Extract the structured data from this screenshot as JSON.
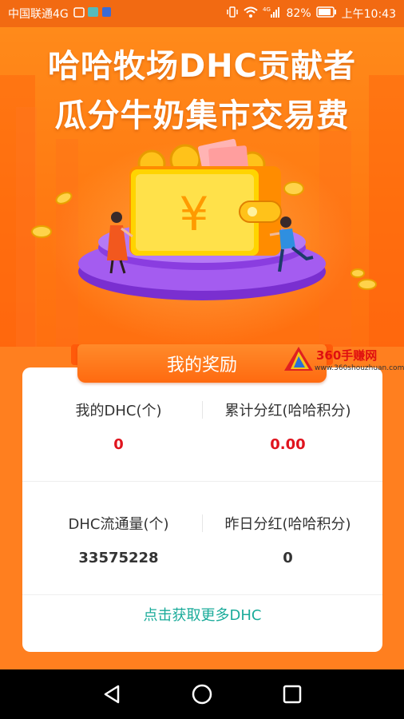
{
  "status_bar": {
    "carrier": "中国联通4G",
    "network_tag": "4G",
    "battery": "82%",
    "time": "上午10:43"
  },
  "hero": {
    "title_line1": "哈哈牧场DHC贡献者",
    "title_line2": "瓜分牛奶集市交易费",
    "wallet_symbol": "¥"
  },
  "watermark": {
    "title": "360手赚网",
    "url": "www.360shouzhuan.com"
  },
  "rewards": {
    "tab_label": "我的奖励",
    "stats": [
      {
        "label": "我的DHC(个)",
        "value": "0"
      },
      {
        "label": "累计分红(哈哈积分)",
        "value": "0.00"
      },
      {
        "label": "DHC流通量(个)",
        "value": "33575228"
      },
      {
        "label": "昨日分红(哈哈积分)",
        "value": "0"
      }
    ],
    "more_link": "点击获取更多DHC"
  },
  "colors": {
    "accent_orange": "#ff7f1f",
    "value_red": "#e0141e",
    "link_teal": "#1aab9a"
  },
  "icons": [
    "signal-icon",
    "wifi-icon",
    "battery-icon",
    "back-icon",
    "home-icon",
    "recents-icon"
  ]
}
